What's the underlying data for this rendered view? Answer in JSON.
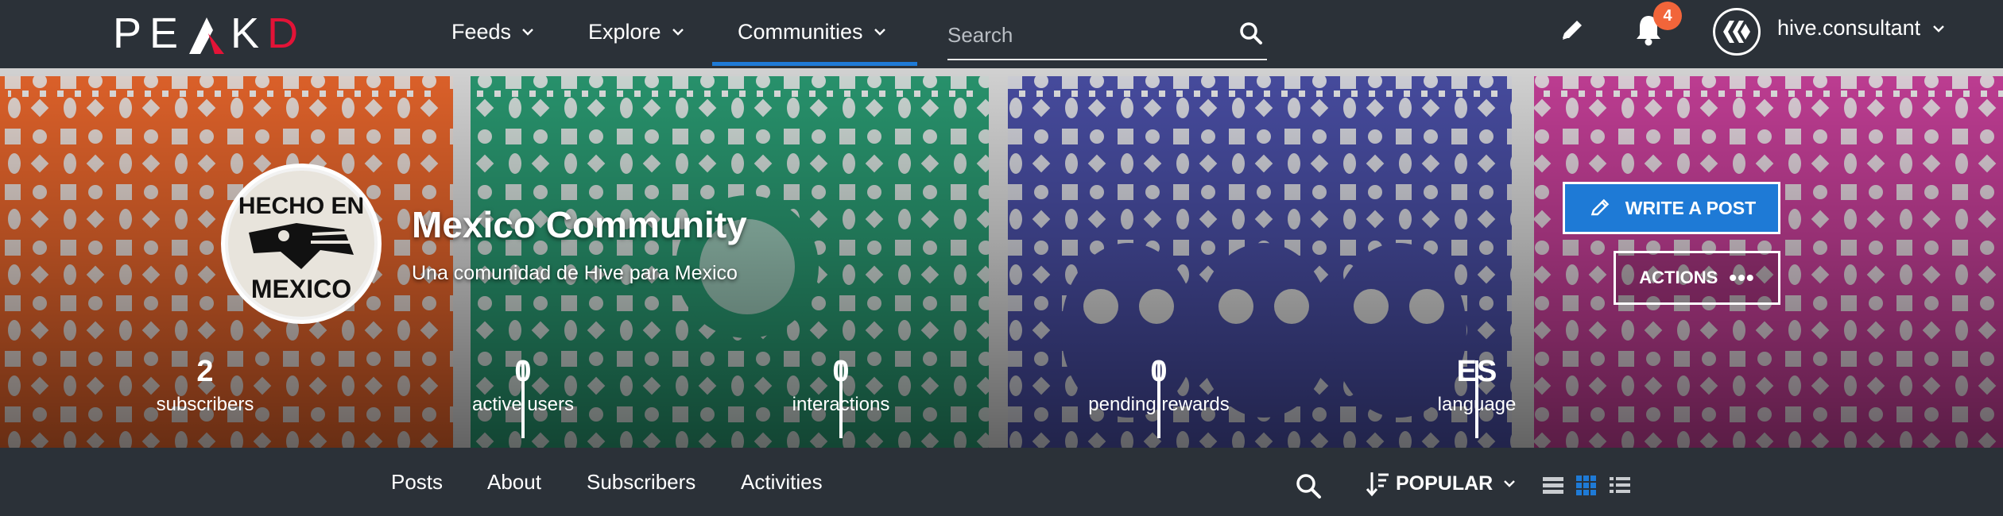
{
  "brand": {
    "logo_text_left": "PE",
    "logo_text_k": "K",
    "logo_text_d": "D"
  },
  "nav": {
    "feeds": "Feeds",
    "explore": "Explore",
    "communities": "Communities",
    "search_placeholder": "Search"
  },
  "header": {
    "notification_count": "4",
    "username": "hive.consultant"
  },
  "community": {
    "title": "Mexico Community",
    "subtitle": "Una comunidad de Hive para Mexico",
    "write_label": "WRITE A POST",
    "actions_label": "ACTIONS",
    "actions_dots": "•••",
    "avatar_text_top": "HECHO EN",
    "avatar_text_bottom": "MEXICO"
  },
  "stats": [
    {
      "value": "2",
      "label": "subscribers"
    },
    {
      "value": "0",
      "label": "active users"
    },
    {
      "value": "0",
      "label": "interactions"
    },
    {
      "value": "0",
      "label": "pending rewards"
    },
    {
      "value": "ES",
      "label": "language"
    }
  ],
  "tabs": {
    "posts": "Posts",
    "about": "About",
    "subscribers": "Subscribers",
    "activities": "Activities"
  },
  "sort": {
    "label": "POPULAR"
  },
  "colors": {
    "bar": "#2b3138",
    "accent": "#1e7ad6",
    "brand_red": "#e31337",
    "badge": "#f2653a",
    "banner_orange": "#e8662c",
    "banner_green": "#2a9a72",
    "banner_blue": "#4a4fa6",
    "banner_magenta": "#c8409a"
  },
  "icons": [
    "pencil-icon",
    "bell-icon",
    "hive-logo-icon",
    "search-icon",
    "sort-icon",
    "chevron-down-icon",
    "list-view-icon",
    "grid-view-icon",
    "compact-view-icon"
  ]
}
